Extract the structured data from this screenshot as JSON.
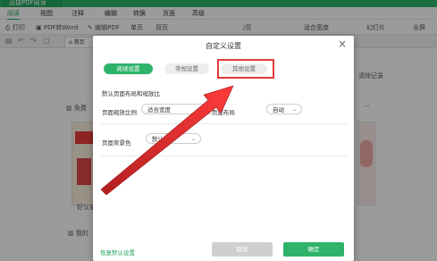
{
  "app": {
    "title": "迅捷PDF阅读"
  },
  "menu": [
    "阅读",
    "视图",
    "注释",
    "编辑",
    "转换",
    "页面",
    "高级"
  ],
  "toolbar": [
    "打印",
    "PDF转Word",
    "编辑PDF",
    "单页",
    "双页",
    "/页",
    "适合宽度",
    "幻灯片",
    "全屏"
  ],
  "tabs": {
    "home": "首页"
  },
  "background": {
    "clear_history": "清除记录",
    "more": "···",
    "free_label": "免费",
    "book1_title": "好父亲",
    "my_label": "我的"
  },
  "dialog": {
    "title": "自定义设置",
    "close": "×",
    "tabs": {
      "reading": "阅读设置",
      "general": "常规设置",
      "other": "其他设置"
    },
    "section_title": "默认页面布局和缩放比",
    "zoom_label": "页面缩放比例",
    "zoom_value": "适合宽度",
    "layout_label": "页面布局",
    "layout_value": "自动",
    "bg_label": "页面背景色",
    "bg_value": "默认",
    "restore": "恢复默认设置",
    "cancel": "取消",
    "ok": "确定"
  },
  "colors": {
    "accent": "#2fb36a",
    "highlight": "#e53b3b"
  }
}
